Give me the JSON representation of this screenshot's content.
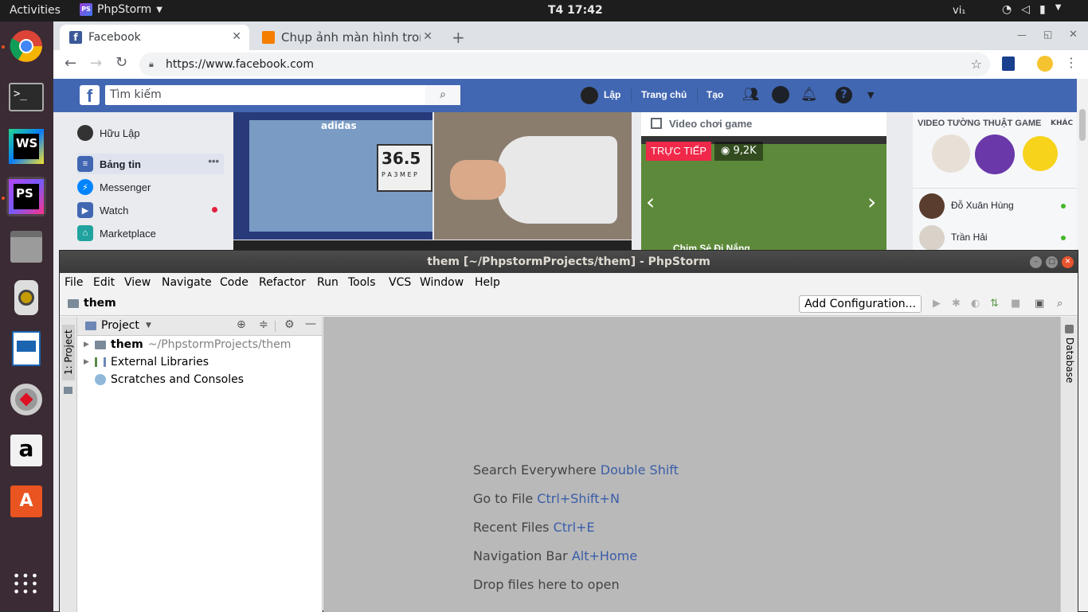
{
  "topbar": {
    "activities": "Activities",
    "app_name": "PhpStorm",
    "clock": "T4 17:42",
    "lang": "vi₁"
  },
  "dock": {
    "items": [
      "chrome-icon",
      "terminal-icon",
      "webstorm-icon",
      "phpstorm-icon",
      "files-icon",
      "rhythmbox-icon",
      "writer-icon",
      "settings-icon",
      "amazon-icon",
      "software-center-icon",
      "app-grid-icon"
    ]
  },
  "chrome": {
    "tabs": [
      {
        "label": "Facebook"
      },
      {
        "label": "Chụp ảnh màn hình tron"
      }
    ],
    "url": "https://www.facebook.com"
  },
  "facebook": {
    "search_placeholder": "Tìm kiếm",
    "nav": {
      "user": "Lập",
      "home": "Trang chủ",
      "create": "Tạo"
    },
    "left": {
      "profile": "Hữu Lập",
      "items": [
        {
          "label": "Bảng tin"
        },
        {
          "label": "Messenger"
        },
        {
          "label": "Watch"
        },
        {
          "label": "Marketplace"
        }
      ]
    },
    "post": {
      "box_text": "36.5",
      "box_sub": "P A 3 M E P",
      "brand": "adidas"
    },
    "video": {
      "header": "Video chơi game",
      "live_badge": "TRỰC TIẾP",
      "views": "9,2K",
      "caption": "Chim Sẻ Đi Nắng"
    },
    "right": {
      "section": "VIDEO TƯỜNG THUẬT GAME",
      "more": "KHÁC",
      "contacts": [
        "Đỗ Xuân Hùng",
        "Trần Hải"
      ]
    }
  },
  "phpstorm": {
    "title": "them [~/PhpstormProjects/them] - PhpStorm",
    "menu": [
      "File",
      "Edit",
      "View",
      "Navigate",
      "Code",
      "Refactor",
      "Run",
      "Tools",
      "VCS",
      "Window",
      "Help"
    ],
    "breadcrumb": "them",
    "add_config": "Add Configuration...",
    "left_tool": "1: Project",
    "right_tool": "Database",
    "project_header": "Project",
    "tree": [
      {
        "name": "them",
        "path": "~/PhpstormProjects/them"
      },
      {
        "name": "External Libraries"
      },
      {
        "name": "Scratches and Consoles"
      }
    ],
    "hints": [
      {
        "text": "Search Everywhere",
        "key": "Double Shift"
      },
      {
        "text": "Go to File",
        "key": "Ctrl+Shift+N"
      },
      {
        "text": "Recent Files",
        "key": "Ctrl+E"
      },
      {
        "text": "Navigation Bar",
        "key": "Alt+Home"
      },
      {
        "text": "Drop files here to open",
        "key": ""
      }
    ]
  }
}
